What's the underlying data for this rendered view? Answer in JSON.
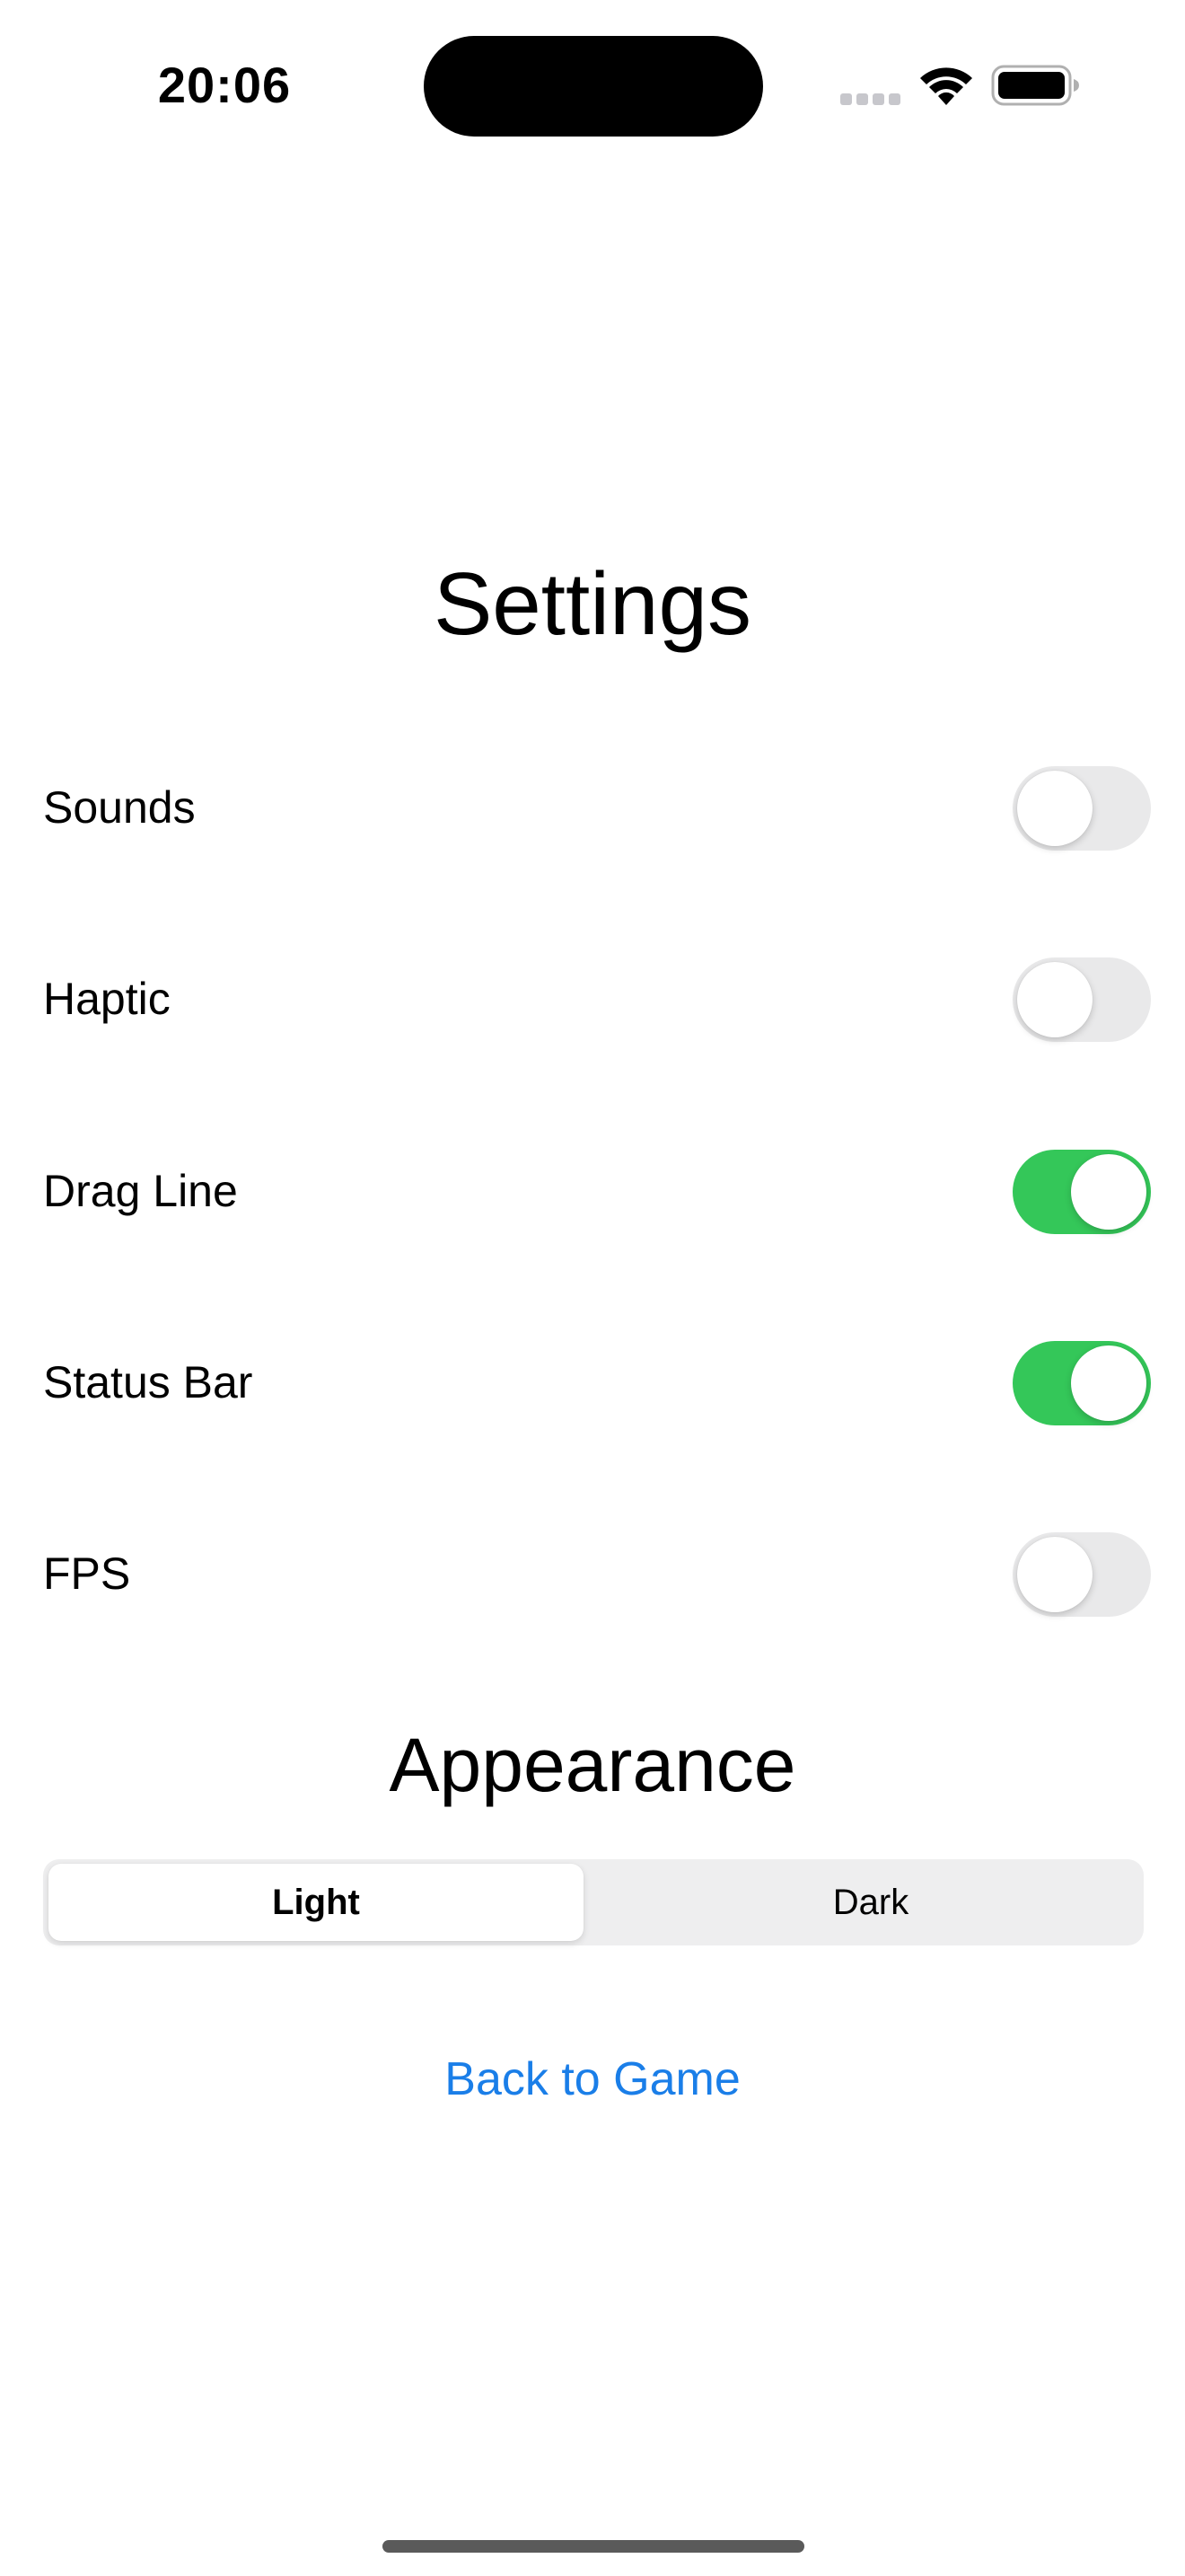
{
  "status_bar": {
    "time": "20:06",
    "icons": [
      "cellular-signal-icon",
      "wifi-icon",
      "battery-icon"
    ]
  },
  "title": "Settings",
  "settings": [
    {
      "label": "Sounds",
      "enabled": false
    },
    {
      "label": "Haptic",
      "enabled": false
    },
    {
      "label": "Drag Line",
      "enabled": true
    },
    {
      "label": "Status Bar",
      "enabled": true
    },
    {
      "label": "FPS",
      "enabled": false
    }
  ],
  "appearance": {
    "title": "Appearance",
    "options": [
      "Light",
      "Dark"
    ],
    "selected": "Light"
  },
  "back_link": "Back to Game",
  "colors": {
    "toggle_on": "#34c759",
    "toggle_off": "#e9e9ea",
    "link": "#1a7ee8",
    "segment_track": "#eeeeef"
  }
}
